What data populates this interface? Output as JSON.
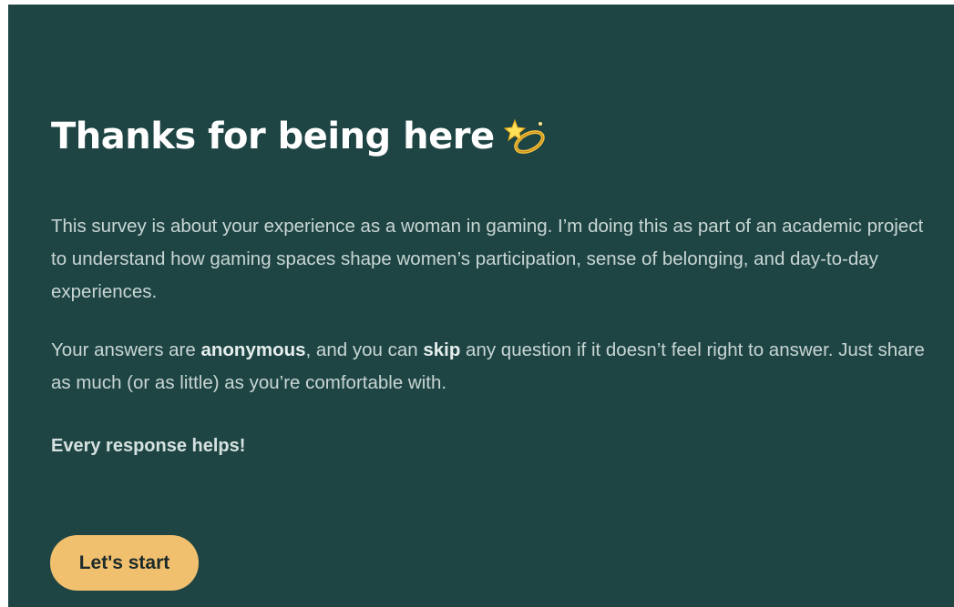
{
  "hero": {
    "title": "Thanks for being here",
    "title_icon": "dizzy-star-icon"
  },
  "intro": {
    "text": "This survey is about your experience as a woman in gaming. I’m doing this as part of an academic project to understand how gaming spaces shape women’s participation, sense of belonging, and day-to-day experiences."
  },
  "privacy": {
    "part1": "Your answers are ",
    "bold1": "anonymous",
    "part2": ", and you can ",
    "bold2": "skip",
    "part3": " any question if it doesn’t feel right to answer. Just share as much (or as little) as you’re comfortable with."
  },
  "closing": {
    "text": "Every response helps!"
  },
  "actions": {
    "start_label": "Let's start"
  },
  "colors": {
    "background": "#1e4544",
    "title": "#ffffff",
    "body_text": "#c8d6d4",
    "button": "#f1c06e",
    "button_text": "#1c2a2a"
  }
}
